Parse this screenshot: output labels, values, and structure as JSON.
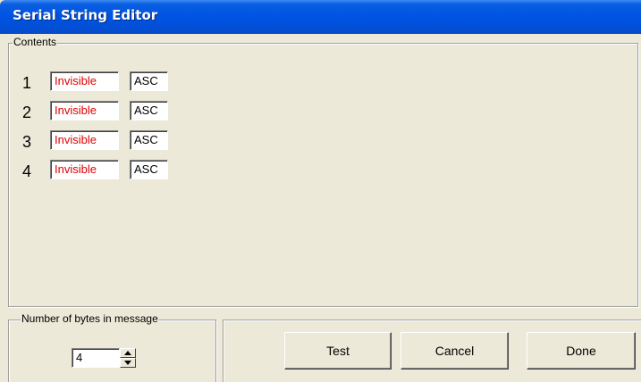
{
  "window": {
    "title": "Serial String Editor"
  },
  "contents": {
    "legend": "Contents",
    "rows": [
      {
        "number": "1",
        "value": "Invisible",
        "format": "ASC"
      },
      {
        "number": "2",
        "value": "Invisible",
        "format": "ASC"
      },
      {
        "number": "3",
        "value": "Invisible",
        "format": "ASC"
      },
      {
        "number": "4",
        "value": "Invisible",
        "format": "ASC"
      }
    ]
  },
  "bytes": {
    "legend": "Number of bytes in message",
    "value": "4"
  },
  "buttons": {
    "test": "Test",
    "cancel": "Cancel",
    "done": "Done"
  },
  "colors": {
    "title_bar": "#0054e3",
    "value_text": "#e00000",
    "window_background": "#ece9d8"
  }
}
